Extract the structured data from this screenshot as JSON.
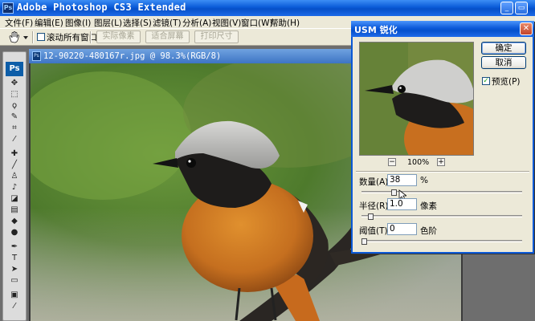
{
  "app": {
    "title": "Adobe Photoshop CS3 Extended",
    "icon_text": "Ps",
    "window_buttons": [
      "minimize-icon",
      "restore-icon"
    ]
  },
  "menu": {
    "items": [
      "文件(F)",
      "编辑(E)",
      "图像(I)",
      "图层(L)",
      "选择(S)",
      "滤镜(T)",
      "分析(A)",
      "视图(V)",
      "窗口(W)",
      "帮助(H)"
    ]
  },
  "options": {
    "scroll_all_label": "滚动所有窗口",
    "actual_pixels": "实际像素",
    "fit_screen": "适合屏幕",
    "print_size": "打印尺寸"
  },
  "toolbox": {
    "badge": "Ps",
    "tools": [
      "move-icon",
      "marquee-icon",
      "lasso-icon",
      "quick-select-icon",
      "crop-icon",
      "eyedropper-icon",
      "healing-icon",
      "brush-icon",
      "clone-stamp-icon",
      "history-brush-icon",
      "eraser-icon",
      "gradient-icon",
      "blur-icon",
      "dodge-icon",
      "pen-icon",
      "type-icon",
      "path-select-icon",
      "shape-icon",
      "notes-icon",
      "hand-icon",
      "zoom-icon"
    ]
  },
  "document": {
    "title": "12-90220-480167r.jpg @ 98.3%(RGB/8)"
  },
  "dialog": {
    "title": "USM 锐化",
    "ok": "确定",
    "cancel": "取消",
    "preview_label": "预览(P)",
    "preview_checked": true,
    "zoom_out": "−",
    "zoom_in": "+",
    "zoom_text": "100%",
    "amount": {
      "label": "数量(A):",
      "value": "38",
      "unit": "%",
      "slider_fraction": 0.19
    },
    "radius": {
      "label": "半径(R):",
      "value": "1.0",
      "unit": "像素",
      "slider_fraction": 0.04
    },
    "threshold": {
      "label": "阈值(T):",
      "value": "0",
      "unit": "色阶",
      "slider_fraction": 0.0
    }
  },
  "colors": {
    "xp_blue": "#0a58d6",
    "dialog_bg": "#ece9d8",
    "bird_orange": "#c9782a"
  }
}
